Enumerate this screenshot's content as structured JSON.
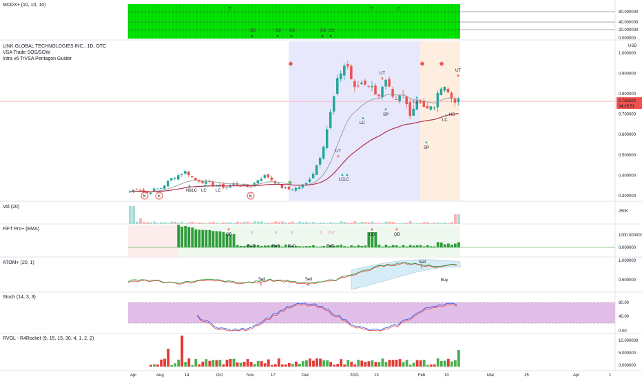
{
  "panes": {
    "mcdx": "MCDX+ (10, 10, 10)",
    "main_title": "LINK GLOBAL TECHNOLOGIES INC., 1D, OTC",
    "main_sub1": "VSA Trade SOS/SOW",
    "main_sub2": "Intra v6 TrVSA Pentagon Guider",
    "vol": "Vol (20)",
    "fift": "FiFT Pro+ (EMA)",
    "atom": "ATOM+ (20, 1)",
    "stoch": "Stoch (14, 3, 3)",
    "rvol": "RVOL - R4Rocket (9, 15, 15, 30, 4, 1, 2, 2)"
  },
  "price_axis": {
    "currency": "USD",
    "ticks": [
      "1.000000",
      "0.900000",
      "0.800000",
      "0.700000",
      "0.600000",
      "0.500000",
      "0.400000",
      "0.300000"
    ],
    "last_price": "0.762500",
    "countdown": "04:05:51"
  },
  "mcdx_axis": [
    "80.000000",
    "40.000000",
    "20.000000",
    "0.000000"
  ],
  "vol_axis": [
    "250K"
  ],
  "fift_axis": [
    "1000.000000",
    "0.000000"
  ],
  "atom_axis": [
    "1.000000",
    "0.500000"
  ],
  "stoch_axis": [
    "80.00",
    "40.00",
    "0.00"
  ],
  "rvol_axis": [
    "10.000000",
    "5.000000",
    "0.000000"
  ],
  "time_axis": [
    "Apr",
    "Aug",
    "14",
    "Oct",
    "Nov",
    "17",
    "Dec",
    "2021",
    "13",
    "Feb",
    "10",
    "Mar",
    "15",
    "Apr",
    "1"
  ],
  "annotations": {
    "e": [
      "E",
      "E",
      "E"
    ],
    "lc": [
      "N&LC",
      "LC",
      "LC",
      "LC",
      "LC",
      "LC",
      "LC",
      "LC"
    ],
    "sp": [
      "SP",
      "SP"
    ],
    "ut": [
      "UT",
      "UT",
      "UT"
    ],
    "hs": [
      "HS"
    ],
    "sell": [
      "Sell",
      "Sell",
      "Sell"
    ],
    "buy": [
      "Buy"
    ],
    "ob": [
      "OB",
      "OB",
      "OB"
    ],
    "bod": [
      "BoD",
      "BoD",
      "BoD",
      "BoD"
    ],
    "mcdx_marks": [
      "G3",
      "G2",
      "G3",
      "G3",
      "G3"
    ]
  },
  "colors": {
    "up": "#26a69a",
    "down": "#ef5350",
    "stoch_band": "#e1bee7",
    "green_block": "#00e400",
    "blue_zone": "#e8e8fc",
    "orange_zone": "#fdeee0"
  },
  "chart_data": {
    "type": "candlestick",
    "title": "LINK GLOBAL TECHNOLOGIES INC., 1D, OTC",
    "ylim": [
      0.28,
      1.05
    ],
    "ohlc_sample_closes": [
      0.32,
      0.34,
      0.31,
      0.33,
      0.34,
      0.38,
      0.4,
      0.42,
      0.38,
      0.37,
      0.36,
      0.35,
      0.34,
      0.36,
      0.35,
      0.34,
      0.38,
      0.4,
      0.37,
      0.34,
      0.33,
      0.34,
      0.36,
      0.42,
      0.52,
      0.7,
      0.88,
      0.96,
      0.82,
      0.86,
      0.84,
      0.79,
      0.86,
      0.75,
      0.8,
      0.7,
      0.78,
      0.72,
      0.74,
      0.86,
      0.78,
      0.76
    ],
    "last": 0.7625
  }
}
